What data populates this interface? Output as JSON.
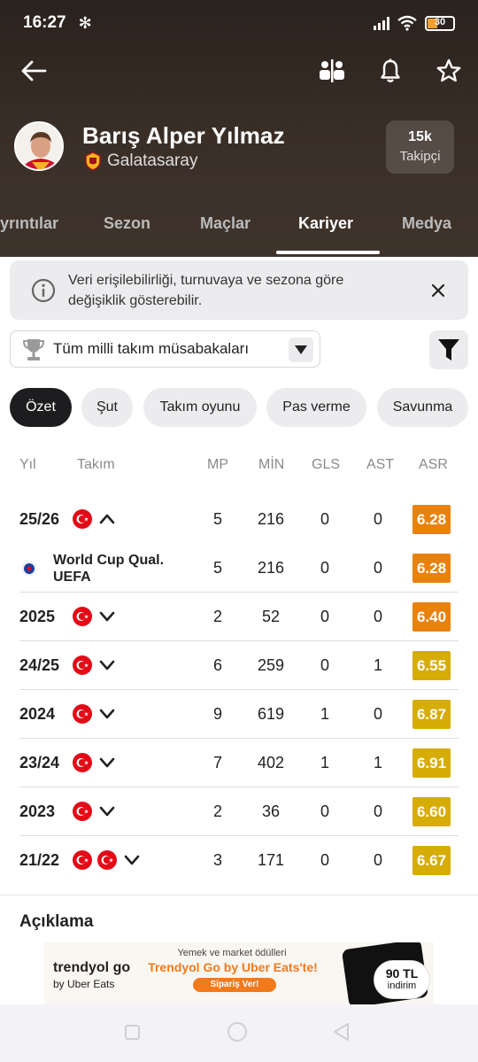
{
  "status": {
    "time": "16:27",
    "battery": "30"
  },
  "player": {
    "name": "Barış Alper Yılmaz",
    "club": "Galatasaray",
    "followers_count": "15k",
    "followers_label": "Takipçi"
  },
  "tabs": [
    {
      "label": "yrıntılar",
      "active": false
    },
    {
      "label": "Sezon",
      "active": false
    },
    {
      "label": "Maçlar",
      "active": false
    },
    {
      "label": "Kariyer",
      "active": true
    },
    {
      "label": "Medya",
      "active": false
    }
  ],
  "info_banner": {
    "text": "Veri erişilebilirliği, turnuvaya ve sezona göre değişiklik gösterebilir."
  },
  "competition_filter": {
    "selected": "Tüm milli takım müsabakaları"
  },
  "stat_chips": [
    {
      "label": "Özet",
      "active": true
    },
    {
      "label": "Şut",
      "active": false
    },
    {
      "label": "Takım oyunu",
      "active": false
    },
    {
      "label": "Pas verme",
      "active": false
    },
    {
      "label": "Savunma",
      "active": false
    }
  ],
  "columns": {
    "year": "Yıl",
    "team": "Takım",
    "mp": "MP",
    "min": "MİN",
    "gls": "GLS",
    "ast": "AST",
    "asr": "ASR"
  },
  "rows": [
    {
      "year": "25/26",
      "flags": 1,
      "expanded": true,
      "mp": "5",
      "min": "216",
      "gls": "0",
      "ast": "0",
      "asr": "6.28",
      "color": "#e8820c"
    },
    {
      "competition": "World Cup Qual. UEFA",
      "sub": true,
      "mp": "5",
      "min": "216",
      "gls": "0",
      "ast": "0",
      "asr": "6.28",
      "color": "#e8820c"
    },
    {
      "year": "2025",
      "flags": 1,
      "expanded": false,
      "mp": "2",
      "min": "52",
      "gls": "0",
      "ast": "0",
      "asr": "6.40",
      "color": "#e8820c"
    },
    {
      "year": "24/25",
      "flags": 1,
      "expanded": false,
      "mp": "6",
      "min": "259",
      "gls": "0",
      "ast": "1",
      "asr": "6.55",
      "color": "#d6ac06"
    },
    {
      "year": "2024",
      "flags": 1,
      "expanded": false,
      "mp": "9",
      "min": "619",
      "gls": "1",
      "ast": "0",
      "asr": "6.87",
      "color": "#d6ac06"
    },
    {
      "year": "23/24",
      "flags": 1,
      "expanded": false,
      "mp": "7",
      "min": "402",
      "gls": "1",
      "ast": "1",
      "asr": "6.91",
      "color": "#d6ac06"
    },
    {
      "year": "2023",
      "flags": 1,
      "expanded": false,
      "mp": "2",
      "min": "36",
      "gls": "0",
      "ast": "0",
      "asr": "6.60",
      "color": "#d6ac06"
    },
    {
      "year": "21/22",
      "flags": 2,
      "expanded": false,
      "mp": "3",
      "min": "171",
      "gls": "0",
      "ast": "0",
      "asr": "6.67",
      "color": "#d6ac06"
    }
  ],
  "description_heading": "Açıklama",
  "ad": {
    "brand": "trendyol go",
    "brand_sub": "by Uber Eats",
    "top_text": "Yemek ve market ödülleri",
    "headline": "Trendyol Go by Uber Eats'te!",
    "cta": "Sipariş Ver!",
    "badge_amount": "90 TL",
    "badge_label": "indirim"
  },
  "colors": {
    "header_bg": "#2f2621",
    "rating_orange": "#e8820c",
    "rating_yellow": "#d6ac06",
    "chip_active": "#1d1d1f"
  }
}
